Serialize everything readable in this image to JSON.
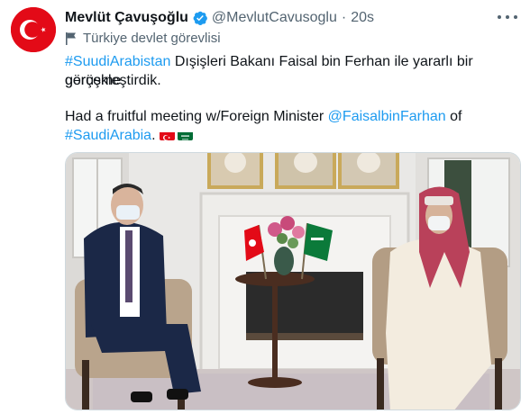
{
  "author": {
    "display_name": "Mevlüt Çavuşoğlu",
    "handle": "@MevlutCavusoglu",
    "separator": "·",
    "time": "20s",
    "affiliation_label": "Türkiye devlet görevlisi"
  },
  "tweet": {
    "line1_hashtag": "#SuudiArabistan",
    "line1_text": " Dışişleri Bakanı Faisal bin Ferhan ile yararlı  bir görüşme",
    "line2_text": "gerçekleştirdik.",
    "line3_text": "Had a fruitful meeting w/Foreign Minister ",
    "line3_mention": "@FaisalbinFarhan",
    "line3_tail": " of",
    "line4_hashtag": "#SaudiArabia",
    "line4_tail": ". "
  },
  "colors": {
    "link": "#1d9bf0",
    "verified": "#1d9bf0",
    "turkey_red": "#e30a17",
    "saudi_green": "#006c35"
  },
  "icons": [
    "verified-badge-icon",
    "government-flag-icon",
    "more-options-icon",
    "turkey-flag-icon",
    "saudi-flag-icon"
  ]
}
